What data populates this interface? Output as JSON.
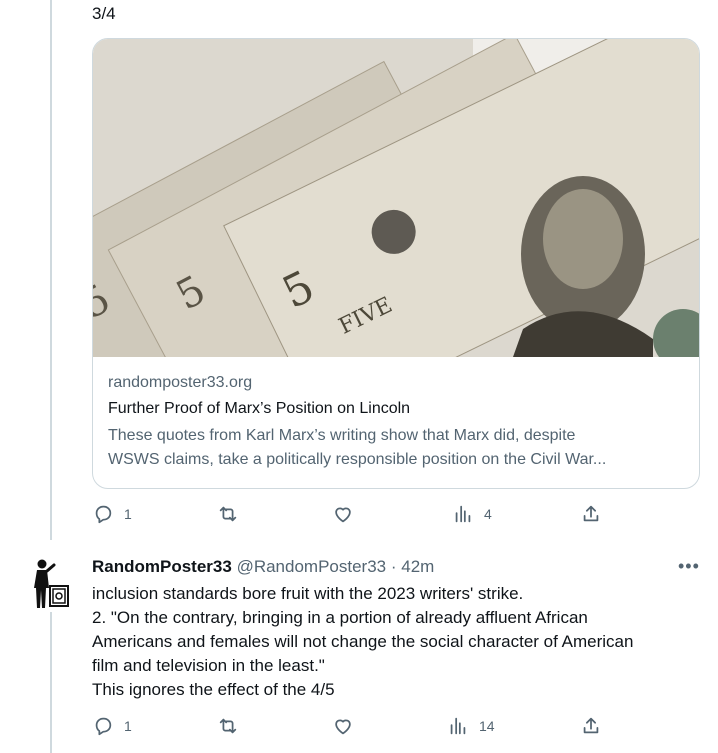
{
  "tweet1": {
    "counter": "3/4",
    "card": {
      "domain": "randomposter33.org",
      "title": "Further Proof of Marx’s Position on Lincoln",
      "description_line1": "These quotes from Karl Marx’s writing show that Marx did, despite",
      "description_line2": "WSWS claims, take a politically responsible position on the Civil War..."
    },
    "actions": {
      "reply_count": "1",
      "repost_count": "",
      "like_count": "",
      "views_count": "4"
    }
  },
  "tweet2": {
    "name": "RandomPoster33",
    "handle": "@RandomPoster33",
    "separator": "·",
    "time": "42m",
    "more_label": "•••",
    "lines": [
      "inclusion standards bore fruit with the 2023 writers' strike.",
      "2. \"On the contrary, bringing in a portion of already affluent African",
      "Americans and females will not change the social character of American",
      "film and television in the least.\"",
      "This ignores the effect of the 4/5"
    ],
    "actions": {
      "reply_count": "1",
      "repost_count": "",
      "like_count": "",
      "views_count": "14"
    }
  },
  "colors": {
    "text": "#0f1419",
    "secondary": "#536471",
    "border": "#cfd9de"
  }
}
